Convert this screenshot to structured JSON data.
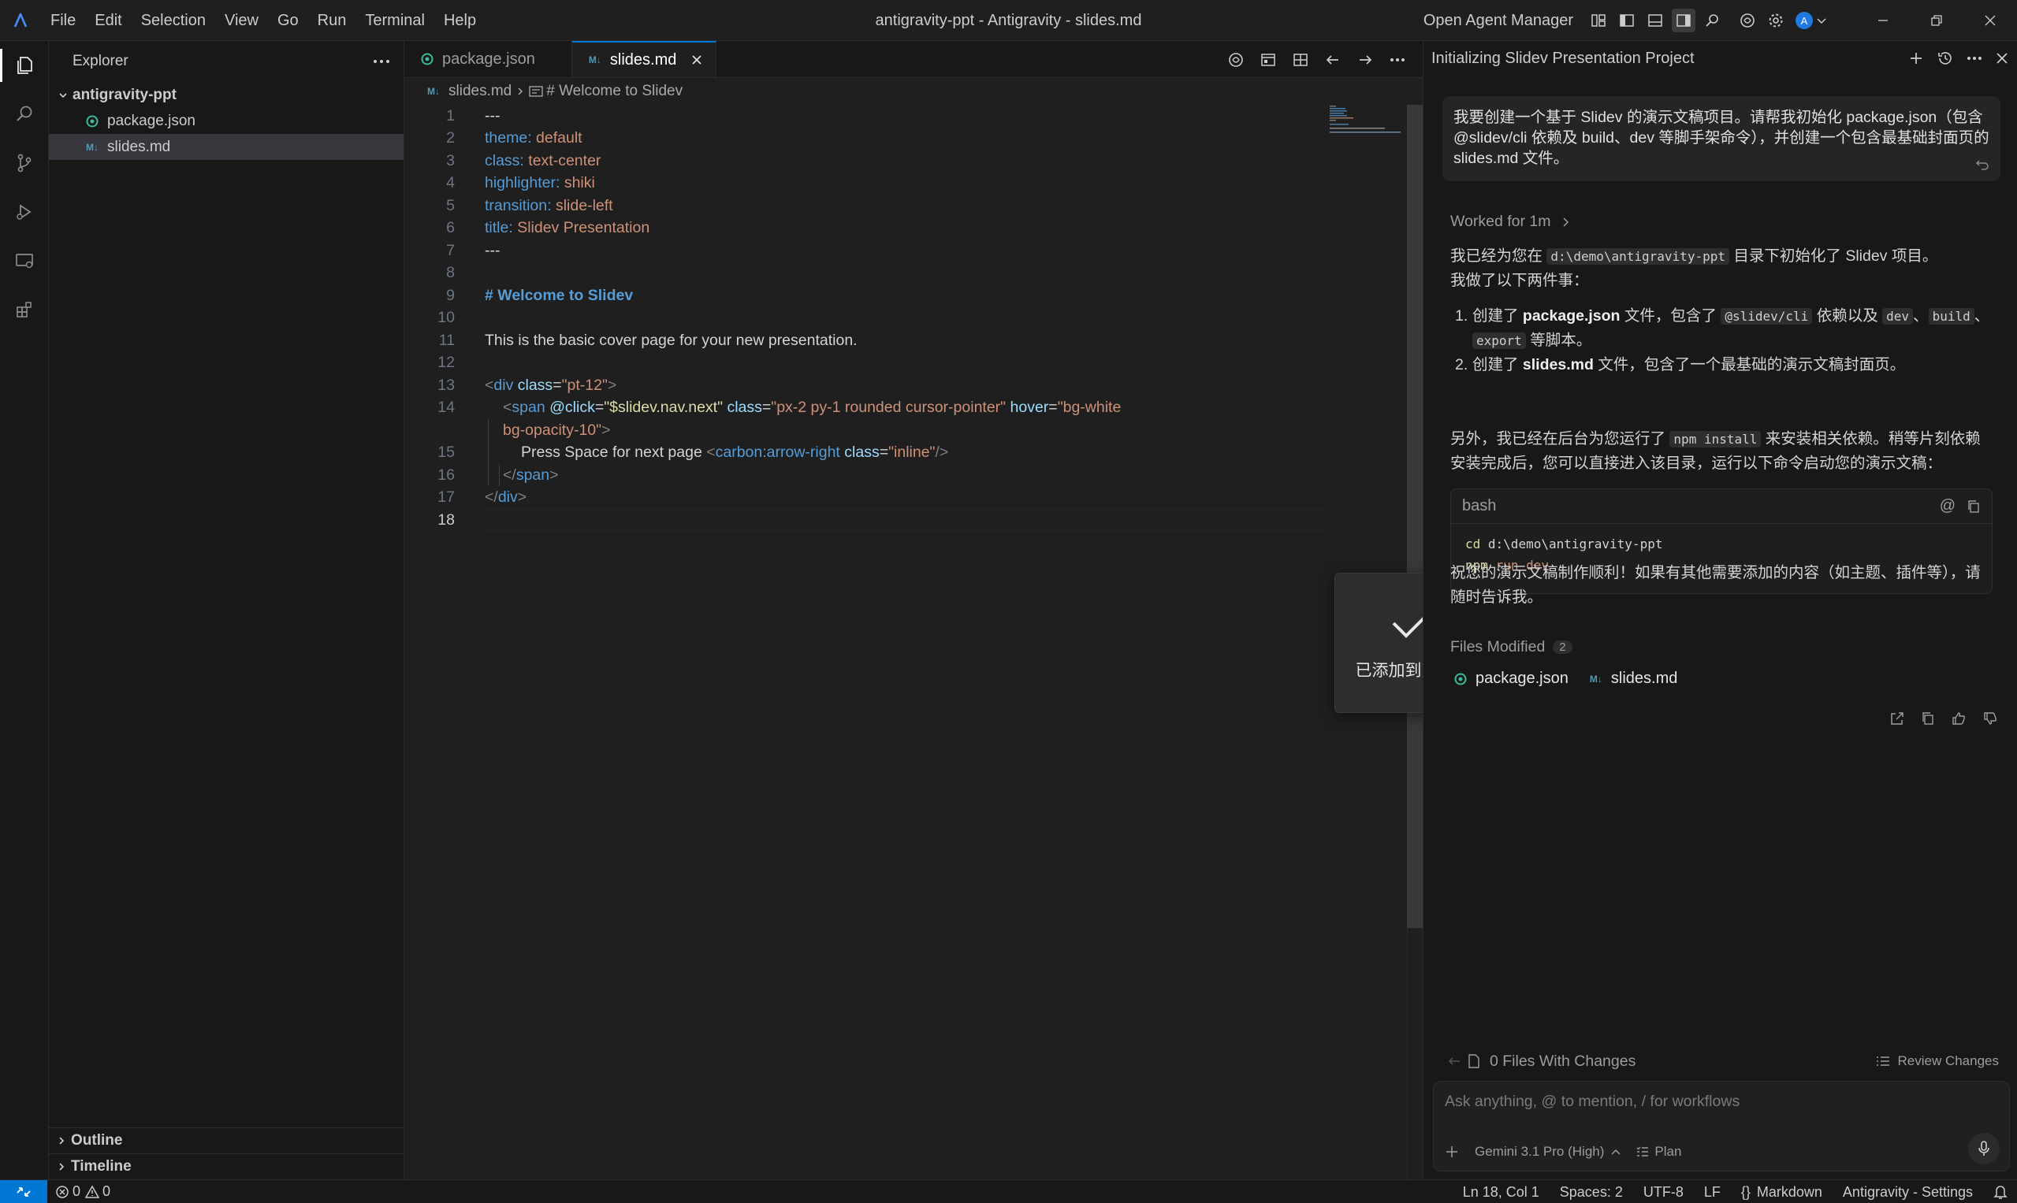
{
  "window": {
    "title": "antigravity-ppt - Antigravity - slides.md",
    "menus": [
      "File",
      "Edit",
      "Selection",
      "View",
      "Go",
      "Run",
      "Terminal",
      "Help"
    ],
    "open_agent_manager": "Open Agent Manager",
    "avatar_letter": "A"
  },
  "sidebar": {
    "title": "Explorer",
    "folder": "antigravity-ppt",
    "files": [
      {
        "name": "package.json",
        "icon": "json-icon",
        "selected": false
      },
      {
        "name": "slides.md",
        "icon": "markdown-icon",
        "selected": true
      }
    ],
    "sections": [
      "Outline",
      "Timeline"
    ]
  },
  "editor": {
    "tabs": [
      {
        "label": "package.json",
        "active": false
      },
      {
        "label": "slides.md",
        "active": true
      }
    ],
    "breadcrumb": {
      "file": "slides.md",
      "symbol": "# Welcome to Slidev"
    },
    "line_numbers": [
      "1",
      "2",
      "3",
      "4",
      "5",
      "6",
      "7",
      "8",
      "9",
      "10",
      "11",
      "12",
      "13",
      "14",
      "",
      "15",
      "16",
      "17",
      "18"
    ],
    "current_line": "18",
    "code": {
      "l1": "---",
      "l2_key": "theme:",
      "l2_val": "default",
      "l3_key": "class:",
      "l3_val": "text-center",
      "l4_key": "highlighter:",
      "l4_val": "shiki",
      "l5_key": "transition:",
      "l5_val": "slide-left",
      "l6_key": "title:",
      "l6_val": "Slidev Presentation",
      "l7": "---",
      "l9": "# Welcome to Slidev",
      "l11": "This is the basic cover page for your new presentation.",
      "l13_tag": "div",
      "l13_attr": "class",
      "l13_val": "\"pt-12\"",
      "l14_tag": "span",
      "l14_attr1": "@click",
      "l14_val1": "\"$slidev.nav.next\"",
      "l14_attr2": "class",
      "l14_val2": "\"px-2 py-1 rounded cursor-pointer\"",
      "l14_attr3": "hover",
      "l14_val3": "\"bg-white",
      "l14b": "bg-opacity-10\"",
      "l15_text": "Press Space for next page ",
      "l15_tag": "carbon:arrow-right",
      "l15_attr": "class",
      "l15_val": "\"inline\"",
      "l16_tag": "span",
      "l17_tag": "div"
    },
    "toast": "已添加到剪贴板"
  },
  "agent": {
    "title": "Initializing Slidev Presentation Project",
    "user_message": "我要创建一个基于 Slidev 的演示文稿项目。请帮我初始化 package.json（包含 @slidev/cli 依赖及 build、dev 等脚手架命令），并创建一个包含最基础封面页的 slides.md 文件。",
    "worked": "Worked for 1m",
    "p1_a": "我已经为您在 ",
    "p1_code": "d:\\demo\\antigravity-ppt",
    "p1_b": " 目录下初始化了 Slidev 项目。",
    "p1_c": "我做了以下两件事：",
    "li1_a": "创建了 ",
    "li1_b": "package.json",
    "li1_c": " 文件，包含了 ",
    "li1_code1": "@slidev/cli",
    "li1_d": " 依赖以及 ",
    "li1_code2": "dev",
    "li1_e": "、",
    "li1_code3": "build",
    "li1_f": "、",
    "li1_code4": "export",
    "li1_g": " 等脚本。",
    "li2_a": "创建了 ",
    "li2_b": "slides.md",
    "li2_c": " 文件，包含了一个最基础的演示文稿封面页。",
    "p2_a": "另外，我已经在后台为您运行了 ",
    "p2_code": "npm install",
    "p2_b": " 来安装相关依赖。稍等片刻依赖安装完成后，您可以直接进入该目录，运行以下命令启动您的演示文稿：",
    "codeblock": {
      "lang": "bash",
      "line1_cmd": "cd",
      "line1_arg": "d:\\demo\\antigravity-ppt",
      "line2_cmd": "npm",
      "line2_arg": "run dev"
    },
    "p3": "祝您的演示文稿制作顺利！如果有其他需要添加的内容（如主题、插件等），请随时告诉我。",
    "files_modified": "Files Modified",
    "files_modified_count": "2",
    "files": [
      "package.json",
      "slides.md"
    ],
    "changes": "0 Files With Changes",
    "review": "Review Changes",
    "input_placeholder": "Ask anything, @ to mention, / for workflows",
    "model": "Gemini 3.1 Pro (High)",
    "mode": "Plan"
  },
  "statusbar": {
    "errors": "0",
    "warnings": "0",
    "position": "Ln 18, Col 1",
    "spaces": "Spaces: 2",
    "encoding": "UTF-8",
    "eol": "LF",
    "language": "Markdown",
    "settings": "Antigravity - Settings"
  },
  "colors": {
    "accent": "#0078d4",
    "background": "#1f1f1f"
  }
}
